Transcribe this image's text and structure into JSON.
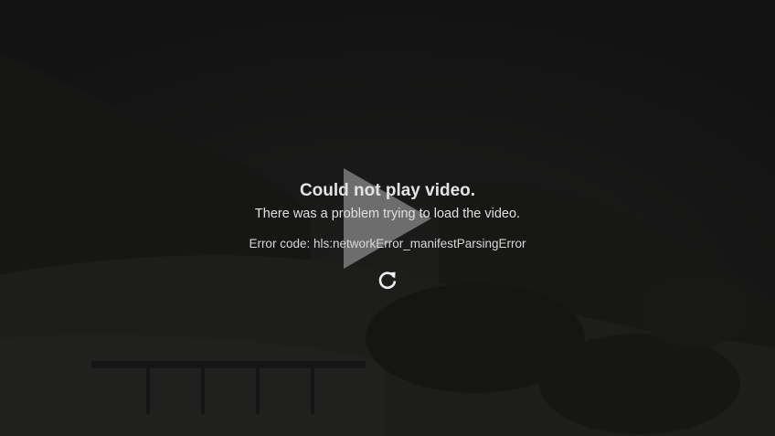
{
  "player": {
    "state": "error",
    "poster_icon": "play-icon",
    "retry_icon": "refresh-icon",
    "colors": {
      "background": "#161616",
      "text": "#e3e3e3",
      "play_icon": "#8a8a8a"
    }
  },
  "error": {
    "title": "Could not play video.",
    "message": "There was a problem trying to load the video.",
    "code": "Error code: hls:networkError_manifestParsingError"
  }
}
